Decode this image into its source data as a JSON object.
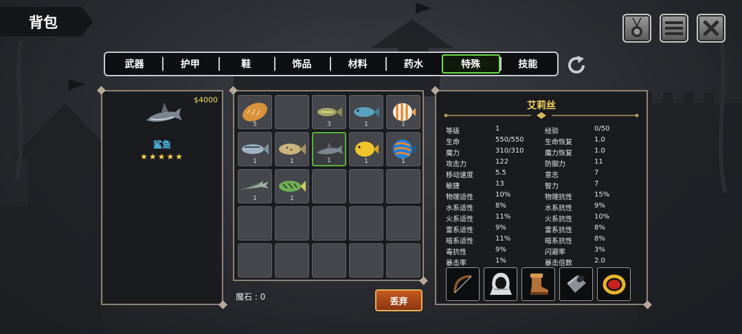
{
  "header": {
    "title": "背包"
  },
  "tabs": [
    {
      "label": "武器"
    },
    {
      "label": "护甲"
    },
    {
      "label": "鞋"
    },
    {
      "label": "饰品"
    },
    {
      "label": "材料"
    },
    {
      "label": "药水"
    },
    {
      "label": "特殊",
      "active": true
    },
    {
      "label": "技能"
    }
  ],
  "detail": {
    "price": "$4000",
    "name": "鲨鱼",
    "stars": "★★★★★"
  },
  "inventory": {
    "counts": [
      "5",
      "",
      "3",
      "1",
      "1",
      "1",
      "1",
      "1",
      "1",
      "1",
      "1",
      "1"
    ],
    "items": [
      "bread",
      "empty",
      "fish",
      "fish",
      "butterflyfish",
      "fish",
      "fish",
      "shark",
      "yellow-fish",
      "discus-fish",
      "barracuda",
      "fish"
    ]
  },
  "footer": {
    "magic_stone": "魔石 : 0",
    "discard_label": "丢弃"
  },
  "character": {
    "name": "艾莉丝",
    "stats": [
      [
        "等级",
        "1",
        "经验",
        "0/50"
      ],
      [
        "生命",
        "550/550",
        "生命恢复",
        "1.0"
      ],
      [
        "魔力",
        "310/310",
        "魔力恢复",
        "1.0"
      ],
      [
        "攻击力",
        "122",
        "防御力",
        "11"
      ],
      [
        "移动速度",
        "5.5",
        "意志",
        "7"
      ],
      [
        "敏捷",
        "13",
        "智力",
        "7"
      ],
      [
        "物理适性",
        "10%",
        "物理抗性",
        "15%"
      ],
      [
        "水系适性",
        "8%",
        "水系抗性",
        "9%"
      ],
      [
        "火系适性",
        "11%",
        "火系抗性",
        "10%"
      ],
      [
        "雷系适性",
        "9%",
        "雷系抗性",
        "8%"
      ],
      [
        "暗系适性",
        "11%",
        "暗系抗性",
        "8%"
      ],
      [
        "毒抗性",
        "9%",
        "闪避率",
        "3%"
      ],
      [
        "暴击率",
        "1%",
        "暴击倍数",
        "2.0"
      ]
    ],
    "equipment": [
      "bow-icon",
      "hood-icon",
      "boots-icon",
      "bracer-icon",
      "ring-icon"
    ]
  },
  "colors": {
    "accent_gold": "#f3d35b",
    "item_name_blue": "#53c2f0",
    "active_tab_green": "#6fdc4d",
    "discard_orange": "#c65a1f"
  }
}
